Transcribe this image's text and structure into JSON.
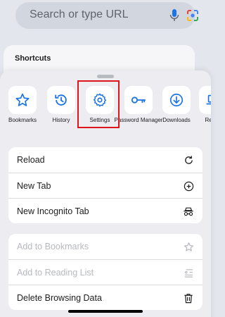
{
  "search": {
    "placeholder": "Search or type URL"
  },
  "shortcuts": {
    "title": "Shortcuts"
  },
  "actions": [
    {
      "label": "Bookmarks",
      "icon": "star-icon"
    },
    {
      "label": "History",
      "icon": "history-icon"
    },
    {
      "label": "Settings",
      "icon": "gear-icon"
    },
    {
      "label": "Password Manager",
      "icon": "key-icon"
    },
    {
      "label": "Downloads",
      "icon": "download-icon"
    },
    {
      "label": "Recen",
      "icon": "laptop-icon"
    }
  ],
  "group1": [
    {
      "label": "Reload",
      "icon": "reload-icon"
    },
    {
      "label": "New Tab",
      "icon": "plus-circle-icon"
    },
    {
      "label": "New Incognito Tab",
      "icon": "incognito-icon"
    }
  ],
  "group2": [
    {
      "label": "Add to Bookmarks",
      "icon": "star-outline-icon",
      "disabled": true
    },
    {
      "label": "Add to Reading List",
      "icon": "reading-list-icon",
      "disabled": true
    },
    {
      "label": "Delete Browsing Data",
      "icon": "trash-icon",
      "disabled": false
    }
  ],
  "colors": {
    "accent": "#1a73e8",
    "highlight": "#e0151c",
    "disabled": "#b7b9be"
  }
}
